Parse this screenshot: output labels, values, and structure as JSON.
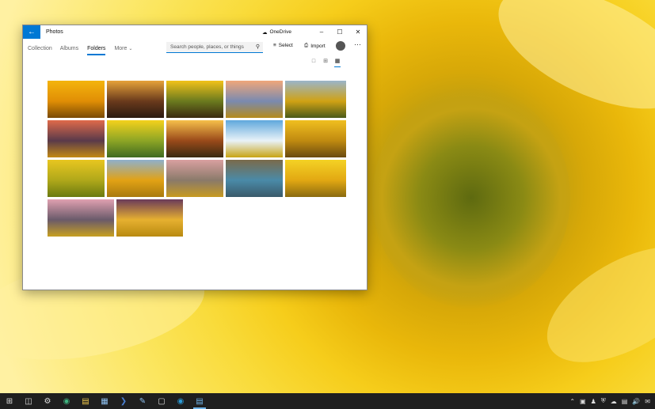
{
  "window": {
    "title": "Photos",
    "onedrive_label": "OneDrive",
    "accent": "#0078d4"
  },
  "nav": {
    "tabs": [
      {
        "label": "Collection",
        "active": false
      },
      {
        "label": "Albums",
        "active": false
      },
      {
        "label": "Folders",
        "active": true
      },
      {
        "label": "More",
        "active": false
      }
    ],
    "search_placeholder": "Search people, places, or things",
    "select_label": "Select",
    "import_label": "Import"
  },
  "view_modes": [
    "large",
    "medium",
    "small"
  ],
  "active_view": "small",
  "thumbnails": [
    {
      "name": "sunflower-closeup",
      "colors": [
        "#f4b40d",
        "#e08e05",
        "#7a4a05"
      ]
    },
    {
      "name": "sunflowers-sunset-silhouette",
      "colors": [
        "#e6a23a",
        "#6a3a1c",
        "#2a1a10"
      ]
    },
    {
      "name": "butterfly-on-sunflower",
      "colors": [
        "#f2c21a",
        "#6b7a1e",
        "#3a2a10"
      ]
    },
    {
      "name": "horses-sunflower-field",
      "colors": [
        "#f0a77a",
        "#7a8ab0",
        "#b58a1a"
      ]
    },
    {
      "name": "sunflower-field-wide",
      "colors": [
        "#9ab5c9",
        "#d0a214",
        "#4a5a1a"
      ]
    },
    {
      "name": "sunflower-field-dusk",
      "colors": [
        "#e06a4a",
        "#5a3a4a",
        "#c28a14"
      ]
    },
    {
      "name": "sunflower-petals-green",
      "colors": [
        "#f4d11c",
        "#8da525",
        "#3f6a20"
      ]
    },
    {
      "name": "sunflowers-backlit",
      "colors": [
        "#f6c04a",
        "#9a4a1a",
        "#3a2a10"
      ]
    },
    {
      "name": "sunflower-field-blue-sky",
      "colors": [
        "#5fa8dc",
        "#e9f2f8",
        "#c8a414"
      ]
    },
    {
      "name": "bee-on-sunflower",
      "colors": [
        "#f0bf20",
        "#c08a10",
        "#6a4a10"
      ]
    },
    {
      "name": "sunflower-macro-green",
      "colors": [
        "#e8c620",
        "#b0a81a",
        "#6a7a10"
      ]
    },
    {
      "name": "sunflower-field-horizon",
      "colors": [
        "#8fb0cc",
        "#e2a214",
        "#a87a10"
      ]
    },
    {
      "name": "barn-sunflower-field",
      "colors": [
        "#d9a0a0",
        "#8a7a6a",
        "#c79a20"
      ]
    },
    {
      "name": "sunflower-seeds-heart",
      "colors": [
        "#7a6a4a",
        "#4a8aa8",
        "#3a5a6a"
      ]
    },
    {
      "name": "sunflower-single-yellow",
      "colors": [
        "#f4d225",
        "#e2a812",
        "#8a6a10"
      ]
    },
    {
      "name": "mountain-sunflower-field",
      "colors": [
        "#e0a0b0",
        "#6a5a6a",
        "#c7a020"
      ]
    },
    {
      "name": "sunflower-field-golden-sunset",
      "colors": [
        "#6a3a5a",
        "#e6b030",
        "#b88a10"
      ]
    }
  ],
  "taskbar": {
    "pinned": [
      "start-icon",
      "task-view-icon",
      "settings-icon",
      "edge-icon",
      "file-explorer-icon",
      "store-icon",
      "powershell-icon",
      "notepad-icon",
      "terminal-icon",
      "edge-beta-icon",
      "photos-icon"
    ],
    "tray": [
      "chevron-up-icon",
      "network-icon",
      "people-icon",
      "shield-icon",
      "onedrive-icon",
      "display-icon",
      "volume-icon",
      "notification-icon"
    ]
  }
}
